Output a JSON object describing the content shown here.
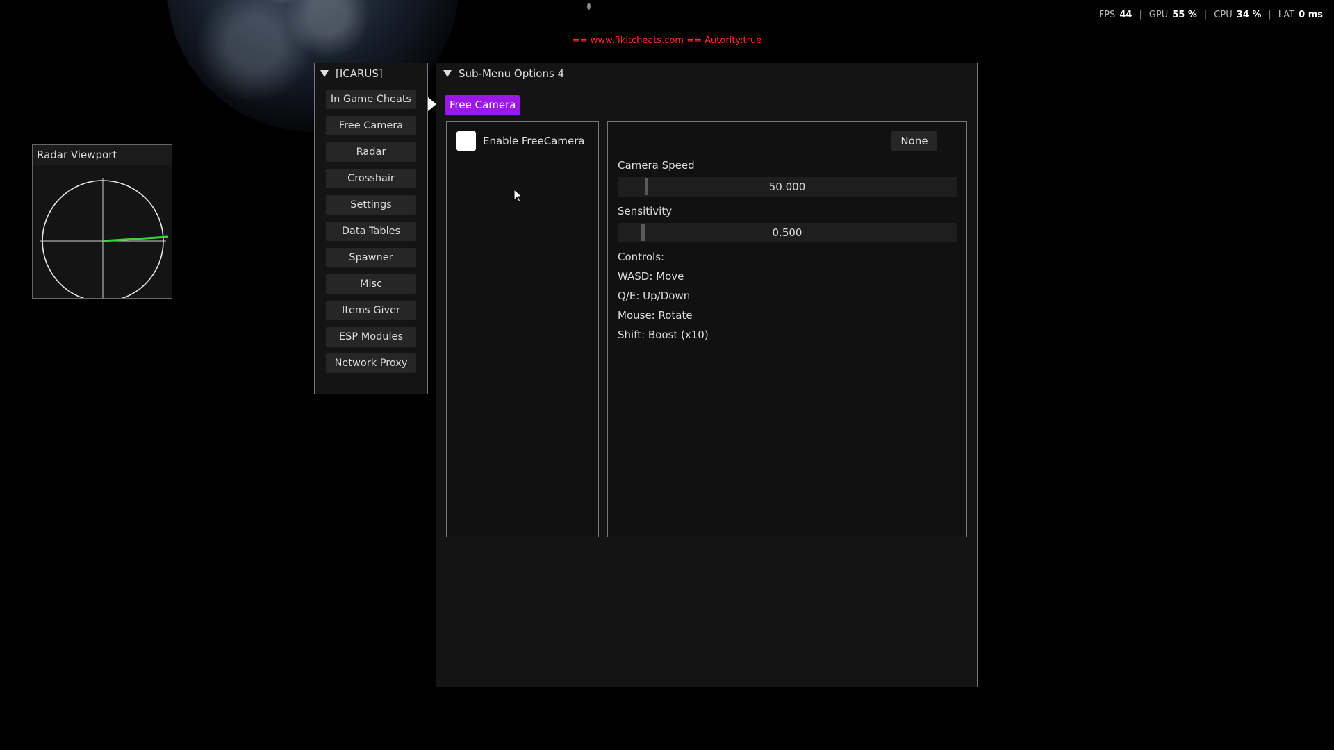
{
  "perf": {
    "fps_label": "FPS",
    "fps_value": "44",
    "gpu_label": "GPU",
    "gpu_value": "55 %",
    "cpu_label": "CPU",
    "cpu_value": "34 %",
    "lat_label": "LAT",
    "lat_value": "0 ms",
    "separator": "|"
  },
  "watermark": "== www.fikitcheats.com == Autority:true",
  "radar": {
    "title": "Radar Viewport",
    "heading_color": "#3cd23c"
  },
  "menu": {
    "title": "[ICARUS]",
    "items": [
      {
        "label": "In Game Cheats"
      },
      {
        "label": "Free Camera"
      },
      {
        "label": "Radar"
      },
      {
        "label": "Crosshair"
      },
      {
        "label": "Settings"
      },
      {
        "label": "Data Tables"
      },
      {
        "label": "Spawner"
      },
      {
        "label": "Misc"
      },
      {
        "label": "Items Giver"
      },
      {
        "label": "ESP Modules"
      },
      {
        "label": "Network Proxy"
      }
    ],
    "selected": "Free Camera"
  },
  "submenu": {
    "title": "Sub-Menu Options 4",
    "tabs": [
      {
        "label": "Free Camera",
        "active": true
      }
    ],
    "accent_color": "#9a19e6",
    "enable_label": "Enable FreeCamera",
    "enable_checked": false,
    "keybind": "None",
    "camera_speed": {
      "label": "Camera Speed",
      "value": "50.000",
      "fraction": 0.08
    },
    "sensitivity": {
      "label": "Sensitivity",
      "value": "0.500",
      "fraction": 0.07
    },
    "controls_title": "Controls:",
    "controls": [
      "WASD: Move",
      "Q/E: Up/Down",
      "Mouse: Rotate",
      "Shift: Boost (x10)"
    ]
  }
}
